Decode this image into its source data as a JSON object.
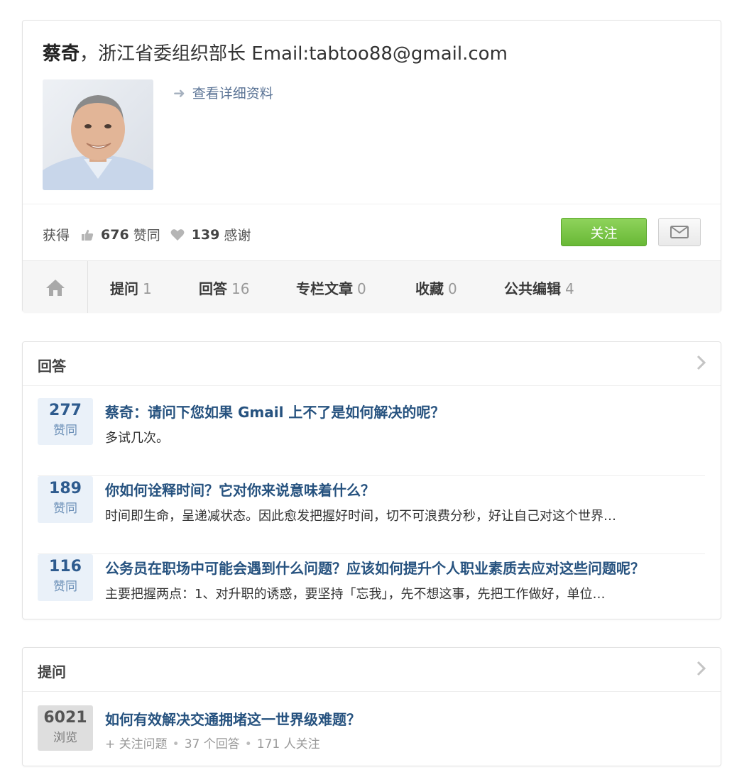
{
  "profile": {
    "name": "蔡奇",
    "separator": "，",
    "headline": "浙江省委组织部长 Email:tabtoo88@gmail.com",
    "detail_link": "查看详细资料",
    "stats": {
      "prefix": "获得",
      "likes": "676",
      "likes_label": "赞同",
      "thanks": "139",
      "thanks_label": "感谢"
    },
    "follow_label": "关注",
    "tabs": [
      {
        "label": "提问",
        "count": "1"
      },
      {
        "label": "回答",
        "count": "16"
      },
      {
        "label": "专栏文章",
        "count": "0"
      },
      {
        "label": "收藏",
        "count": "0"
      },
      {
        "label": "公共编辑",
        "count": "4"
      }
    ]
  },
  "answers": {
    "title": "回答",
    "items": [
      {
        "votes": "277",
        "votes_label": "赞同",
        "title": "蔡奇：请问下您如果 Gmail 上不了是如何解决的呢？",
        "excerpt": "多试几次。"
      },
      {
        "votes": "189",
        "votes_label": "赞同",
        "title": "你如何诠释时间？它对你来说意味着什么？",
        "excerpt": "时间即生命，呈递减状态。因此愈发把握好时间，切不可浪费分秒，好让自己对这个世界…"
      },
      {
        "votes": "116",
        "votes_label": "赞同",
        "title": "公务员在职场中可能会遇到什么问题？应该如何提升个人职业素质去应对这些问题呢？",
        "excerpt": "主要把握两点：1、对升职的诱惑，要坚持「忘我」，先不想这事，先把工作做好，单位…"
      }
    ]
  },
  "questions": {
    "title": "提问",
    "items": [
      {
        "views": "6021",
        "views_label": "浏览",
        "title": "如何有效解决交通拥堵这一世界级难题？",
        "follow_label": "关注问题",
        "answers": "37 个回答",
        "followers": "171 人关注"
      }
    ]
  },
  "colors": {
    "link": "#26527f",
    "follow_button": "#69b836",
    "vote_bg": "#eaf1f9",
    "vote_text": "#2e5b8e"
  }
}
